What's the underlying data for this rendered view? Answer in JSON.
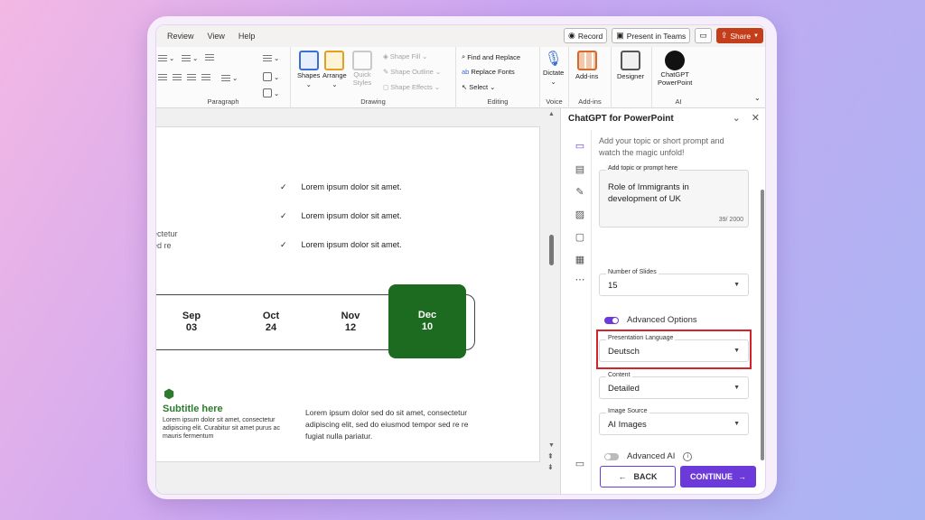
{
  "menu": [
    "Review",
    "View",
    "Help"
  ],
  "titlebar": {
    "record_label": "Record",
    "present_label": "Present in Teams",
    "share_label": "Share"
  },
  "ribbon": {
    "paragraph_label": "Paragraph",
    "drawing_label": "Drawing",
    "editing_label": "Editing",
    "voice_label": "Voice",
    "addins_label": "Add-ins",
    "ai_label": "AI",
    "shapes": "Shapes",
    "arrange": "Arrange",
    "quick_styles_1": "Quick",
    "quick_styles_2": "Styles",
    "shape_fill": "Shape Fill",
    "shape_outline": "Shape Outline",
    "shape_effects": "Shape Effects",
    "find_replace": "Find and Replace",
    "replace_fonts": "Replace Fonts",
    "select": "Select",
    "dictate": "Dictate",
    "addins": "Add-ins",
    "designer": "Designer",
    "chatgpt_1": "ChatGPT",
    "chatgpt_2": "PowerPoint"
  },
  "slide": {
    "checks": [
      "Lorem ipsum dolor sit amet.",
      "Lorem ipsum dolor sit amet.",
      "Lorem ipsum dolor sit amet."
    ],
    "fragment_1": "ectetur",
    "fragment_2": "ed re",
    "timeline": [
      {
        "month": "Sep",
        "day": "03"
      },
      {
        "month": "Oct",
        "day": "24"
      },
      {
        "month": "Nov",
        "day": "12"
      },
      {
        "month": "Dec",
        "day": "10"
      }
    ],
    "subtitle": "Subtitle here",
    "subtitle_text": "Lorem ipsum dolor sit amet, consectetur adipiscing elit. Curabitur sit amet purus ac mauris fermentum",
    "body_text": "Lorem ipsum dolor sed do sit amet, consectetur adipiscing elit, sed do eiusmod tempor sed re re fugiat nulla pariatur."
  },
  "panel": {
    "title": "ChatGPT for PowerPoint",
    "intro": "Add your topic or short prompt and watch the magic unfold!",
    "topic_label": "Add topic or prompt here",
    "topic_value": "Role of Immigrants in development of UK",
    "topic_counter": "39/ 2000",
    "slides_label": "Number of Slides",
    "slides_value": "15",
    "advanced_options": "Advanced Options",
    "language_label": "Presentation Language",
    "language_value": "Deutsch",
    "content_label": "Content",
    "content_value": "Detailed",
    "image_label": "Image Source",
    "image_value": "AI Images",
    "advanced_ai": "Advanced AI",
    "back": "BACK",
    "continue": "CONTINUE"
  },
  "colors": {
    "accent": "#6b3ad8",
    "highlight": "#d3232b",
    "slide_green": "#1c6b21",
    "share": "#c43e1c"
  }
}
